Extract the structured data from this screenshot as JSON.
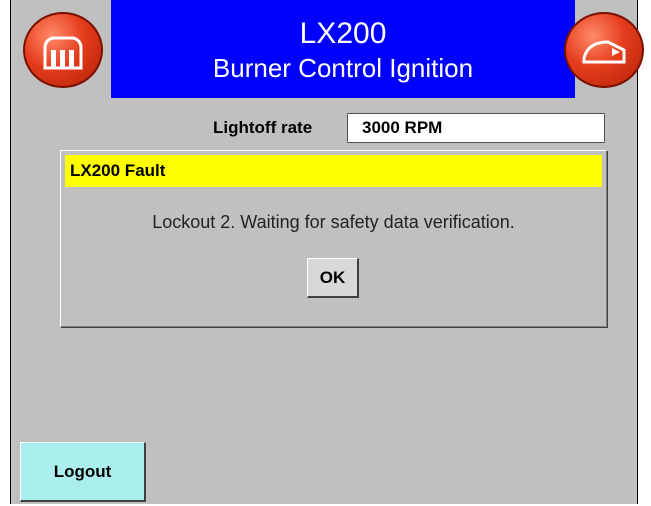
{
  "header": {
    "title": "LX200",
    "subtitle": "Burner Control Ignition",
    "left_icon": "home-icon",
    "right_icon": "burner-icon",
    "color": "#0000ff"
  },
  "lightoff": {
    "label": "Lightoff rate",
    "value": "3000 RPM"
  },
  "dialog": {
    "title": "LX200 Fault",
    "message": "Lockout 2. Waiting for safety data verification.",
    "ok_label": "OK",
    "title_color": "#ffff00"
  },
  "logout_label": "Logout"
}
